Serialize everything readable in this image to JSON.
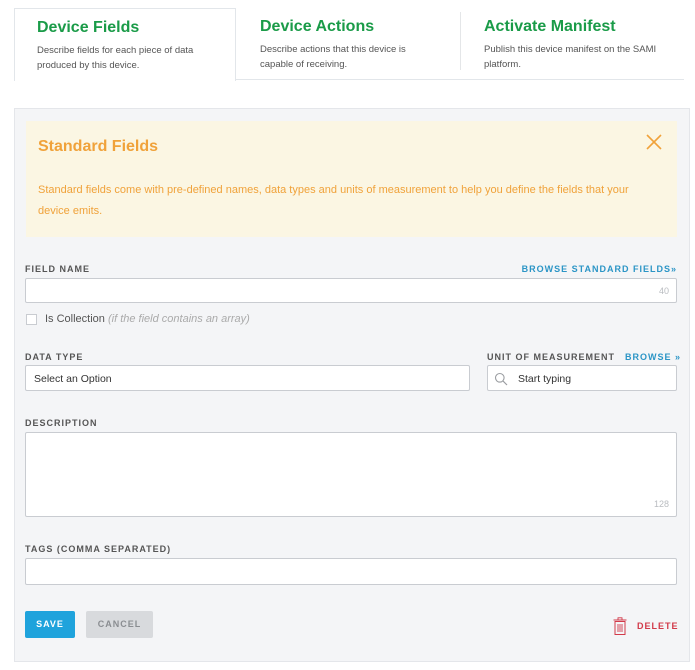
{
  "tabs": [
    {
      "title": "Device Fields",
      "description": "Describe fields for each piece of data produced by this device.",
      "active": true
    },
    {
      "title": "Device Actions",
      "description": "Describe actions that this device is capable of receiving.",
      "active": false
    },
    {
      "title": "Activate Manifest",
      "description": "Publish this device manifest on the SAMI platform.",
      "active": false
    }
  ],
  "banner": {
    "title": "Standard Fields",
    "text": "Standard fields come with pre-defined names, data types and units of measurement to help you define the fields that your device emits.",
    "close_icon": "close-icon"
  },
  "field_name": {
    "label": "FIELD NAME",
    "browse_link": "BROWSE STANDARD FIELDS»",
    "value": "",
    "counter": "40"
  },
  "collection": {
    "label": "Is Collection",
    "hint": "(if the field contains an array)",
    "checked": false
  },
  "data_type": {
    "label": "DATA TYPE",
    "selected": "Select an Option"
  },
  "unit": {
    "label": "UNIT OF MEASUREMENT",
    "browse_link": "BROWSE »",
    "placeholder": "Start typing",
    "icon": "search-icon"
  },
  "description": {
    "label": "DESCRIPTION",
    "value": "",
    "counter": "128"
  },
  "tags": {
    "label": "TAGS (COMMA SEPARATED)",
    "value": ""
  },
  "actions": {
    "save": "SAVE",
    "cancel": "CANCEL",
    "delete": "DELETE",
    "delete_icon": "trash-icon"
  },
  "colors": {
    "tab_title": "#1a9b48",
    "banner_bg": "#fbf6e3",
    "banner_text": "#f0a23a",
    "link": "#2b95c6",
    "save_bg": "#1fa3dc",
    "delete": "#d23a4a"
  }
}
